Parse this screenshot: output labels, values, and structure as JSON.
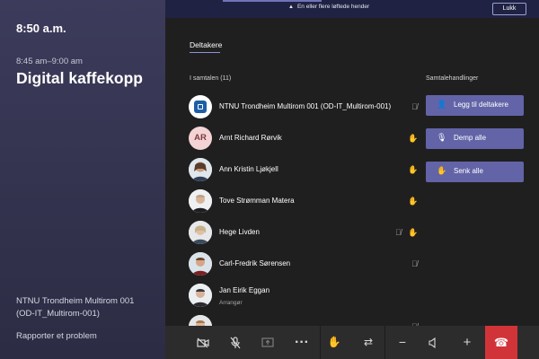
{
  "left_panel": {
    "clock": "8:50 a.m.",
    "time_range": "8:45 am–9:00 am",
    "meeting_title": "Digital kaffekopp",
    "room_line1": "NTNU Trondheim Multirom 001",
    "room_line2": "(OD-IT_Multirom-001)",
    "report_link": "Rapporter et problem"
  },
  "topbar": {
    "notice": "En eller flere løftede hender",
    "close_label": "Lukk"
  },
  "participants_panel": {
    "tab": "Deltakere",
    "section_title": "I samtalen (11)",
    "actions_title": "Samtalehandlinger",
    "participants": [
      {
        "name": "NTNU Trondheim Multirom 001 (OD-IT_Multirom-001)",
        "role": "",
        "muted": true,
        "hand": false
      },
      {
        "name": "Arnt Richard Rørvik",
        "initials": "AR",
        "role": "",
        "muted": false,
        "hand": true
      },
      {
        "name": "Ann Kristin Ljøkjell",
        "role": "",
        "muted": false,
        "hand": true
      },
      {
        "name": "Tove Strømman Matera",
        "role": "",
        "muted": false,
        "hand": true
      },
      {
        "name": "Hege Livden",
        "role": "",
        "muted": true,
        "hand": true
      },
      {
        "name": "Carl-Fredrik Sørensen",
        "role": "",
        "muted": true,
        "hand": false
      },
      {
        "name": "Jan Eirik Eggan",
        "role": "Arrangør",
        "muted": false,
        "hand": false
      }
    ],
    "actions": [
      {
        "label": "Legg til deltakere",
        "icon": "add-person-icon"
      },
      {
        "label": "Demp alle",
        "icon": "mic-off-icon"
      },
      {
        "label": "Senk alle",
        "icon": "hand-icon"
      }
    ]
  },
  "callbar": {
    "buttons": [
      "camera-off-icon",
      "mic-off-icon",
      "share-screen-icon",
      "more-icon",
      "raise-hand-icon",
      "switch-icon",
      "volume-down-icon",
      "speaker-icon",
      "volume-up-icon",
      "hang-up-icon"
    ]
  },
  "colors": {
    "accent": "#6264a7",
    "hand": "#e3b000",
    "hangup": "#d13438"
  }
}
